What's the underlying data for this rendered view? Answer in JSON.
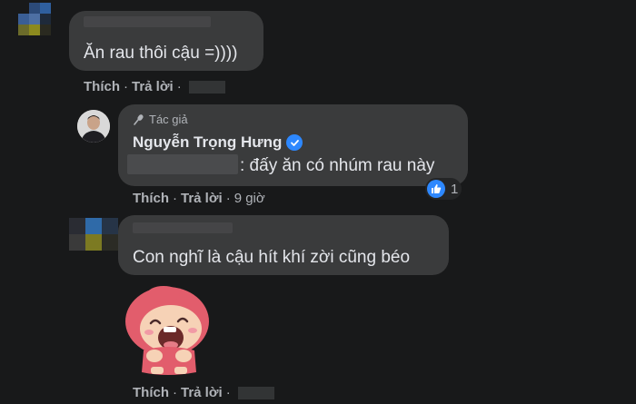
{
  "comments": [
    {
      "text": "Ăn rau thôi cậu =))))",
      "actions": {
        "like": "Thích",
        "reply": "Trả lời",
        "sep": "·"
      }
    },
    {
      "author_tag": "Tác giả",
      "author_name": "Nguyễn Trọng Hưng",
      "text": ": đấy ăn có nhúm rau này",
      "reaction_count": "1",
      "actions": {
        "like": "Thích",
        "reply": "Trả lời",
        "sep": "·",
        "time": "9 giờ"
      }
    },
    {
      "text": "Con nghĩ là cậu hít khí zời cũng béo",
      "actions": {
        "like": "Thích",
        "reply": "Trả lời",
        "sep": "·"
      }
    }
  ],
  "icons": {
    "author": "microphone-icon",
    "verified": "verified-badge-icon",
    "reaction": "like-icon",
    "sticker": "laughing-girl-sticker"
  },
  "colors": {
    "background": "#18191a",
    "bubble": "#3a3b3c",
    "text": "#e4e6eb",
    "secondary": "#b0b3b8",
    "accent": "#2d88ff"
  }
}
